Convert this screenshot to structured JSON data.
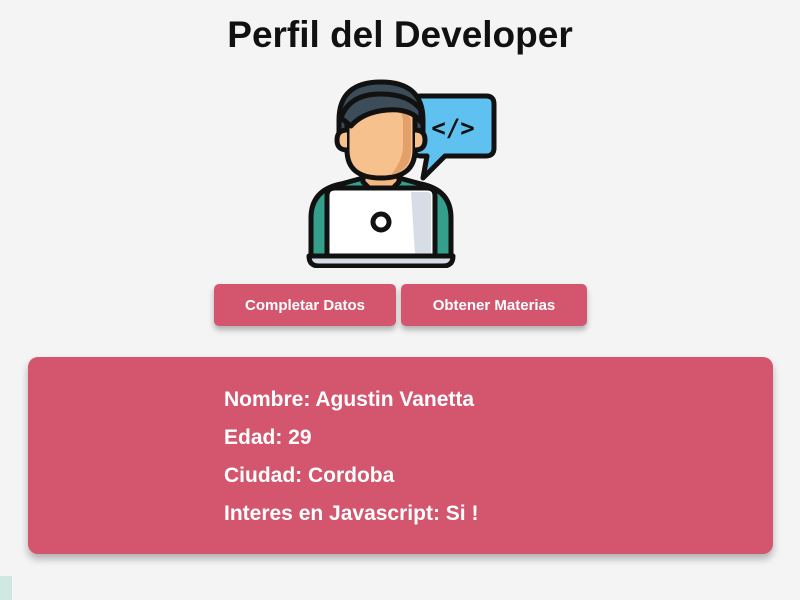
{
  "page": {
    "title": "Perfil del Developer"
  },
  "avatar": {
    "icon": "developer-laptop-code-icon",
    "code_symbol": "</>"
  },
  "actions": {
    "complete_label": "Completar Datos",
    "subjects_label": "Obtener Materias"
  },
  "profile": {
    "name": "Nombre: Agustin Vanetta",
    "age": "Edad: 29",
    "city": "Ciudad: Cordoba",
    "interest": "Interes en Javascript: Si !"
  },
  "colors": {
    "accent": "#d4566e",
    "background": "#f4f4f4",
    "title_text": "#111111",
    "card_text": "#ffffff"
  }
}
